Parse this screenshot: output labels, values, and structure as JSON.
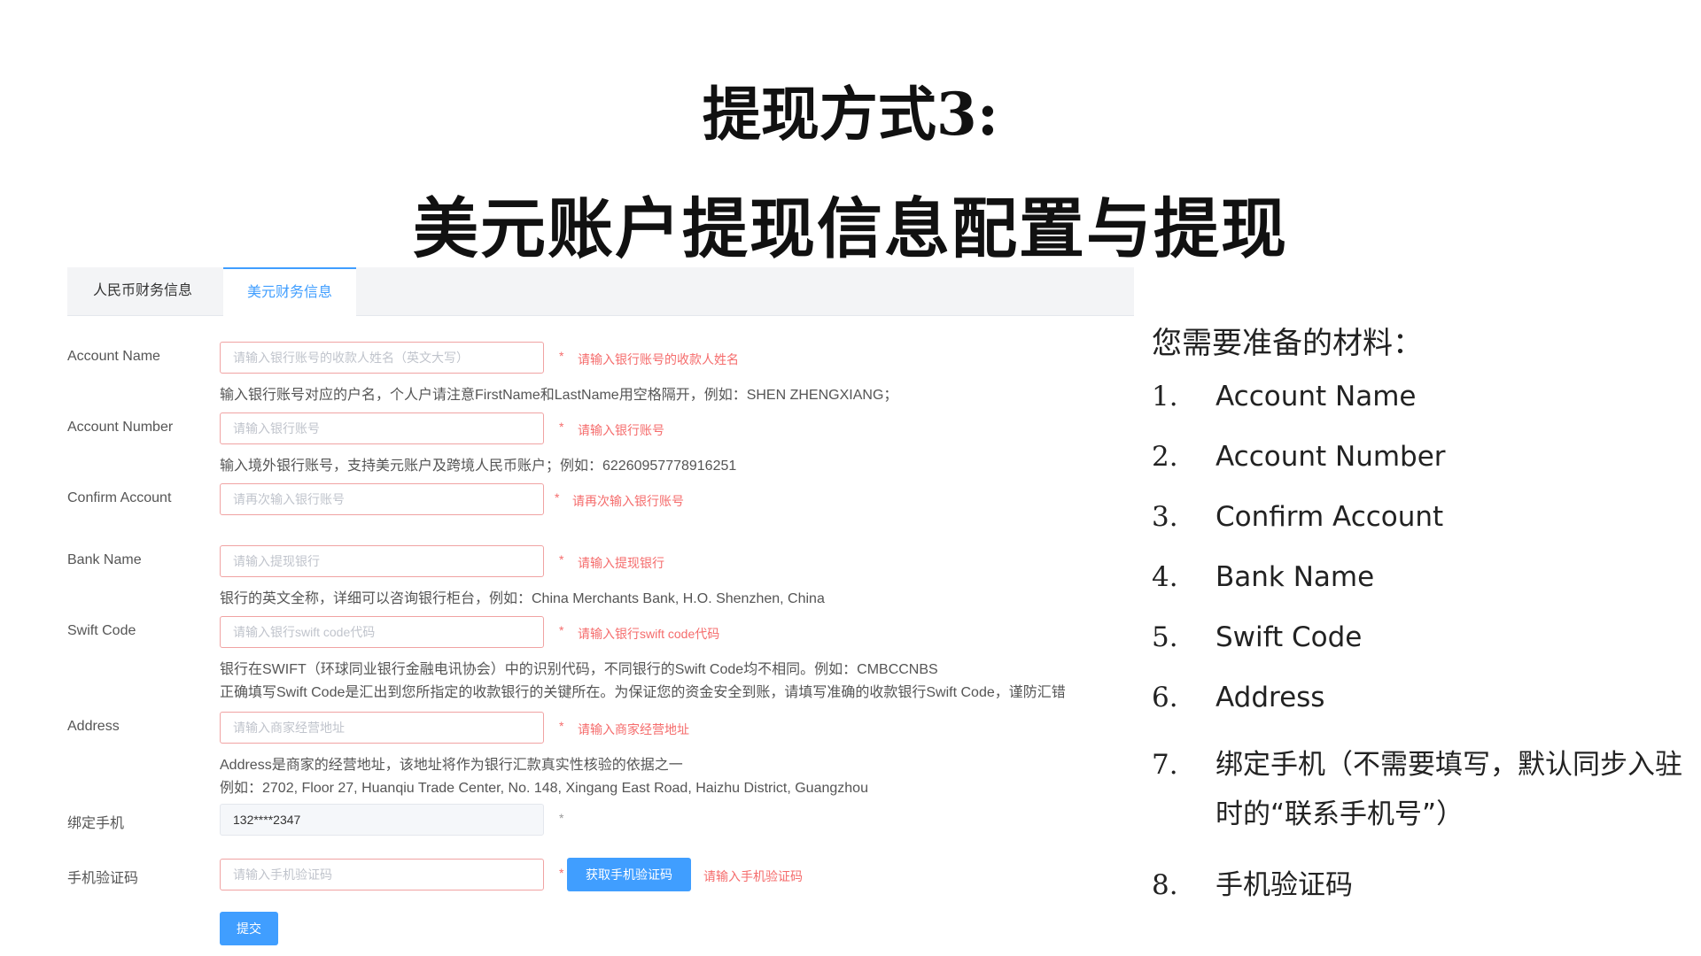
{
  "slide": {
    "title_line1": "提现方式3:",
    "title_line2": "美元账户提现信息配置与提现"
  },
  "tabs": [
    {
      "label": "人民币财务信息",
      "active": false
    },
    {
      "label": "美元财务信息",
      "active": true
    }
  ],
  "form": {
    "account_name": {
      "label": "Account Name",
      "placeholder": "请输入银行账号的收款人姓名（英文大写）",
      "required": "*",
      "error": "请输入银行账号的收款人姓名",
      "hint": "输入银行账号对应的户名，个人户请注意FirstName和LastName用空格隔开，例如：SHEN ZHENGXIANG；"
    },
    "account_number": {
      "label": "Account Number",
      "placeholder": "请输入银行账号",
      "required": "*",
      "error": "请输入银行账号",
      "hint": "输入境外银行账号，支持美元账户及跨境人民币账户；例如：62260957778916251"
    },
    "confirm_account": {
      "label": "Confirm Account",
      "placeholder": "请再次输入银行账号",
      "required": "*",
      "error": "请再次输入银行账号"
    },
    "bank_name": {
      "label": "Bank Name",
      "placeholder": "请输入提现银行",
      "required": "*",
      "error": "请输入提现银行",
      "hint": "银行的英文全称，详细可以咨询银行柜台，例如：China Merchants Bank, H.O. Shenzhen, China"
    },
    "swift_code": {
      "label": "Swift Code",
      "placeholder": "请输入银行swift code代码",
      "required": "*",
      "error": "请输入银行swift code代码",
      "hint1": "银行在SWIFT（环球同业银行金融电讯协会）中的识别代码，不同银行的Swift Code均不相同。例如：CMBCCNBS",
      "hint2": "正确填写Swift Code是汇出到您所指定的收款银行的关键所在。为保证您的资金安全到账，请填写准确的收款银行Swift Code，谨防汇错"
    },
    "address": {
      "label": "Address",
      "placeholder": "请输入商家经营地址",
      "required": "*",
      "error": "请输入商家经营地址",
      "hint1": "Address是商家的经营地址，该地址将作为银行汇款真实性核验的依据之一",
      "hint2": "例如：2702, Floor 27, Huanqiu Trade Center, No. 148, Xingang East Road, Haizhu District, Guangzhou"
    },
    "bound_phone": {
      "label": "绑定手机",
      "value": "132****2347",
      "required": "*"
    },
    "sms_code": {
      "label": "手机验证码",
      "placeholder": "请输入手机验证码",
      "required": "*",
      "button": "获取手机验证码",
      "error": "请输入手机验证码"
    },
    "submit_label": "提交"
  },
  "materials": {
    "heading": "您需要准备的材料：",
    "items": [
      {
        "num": "1.",
        "text": "Account Name"
      },
      {
        "num": "2.",
        "text": "Account Number"
      },
      {
        "num": "3.",
        "text": "Confirm Account"
      },
      {
        "num": "4.",
        "text": "Bank Name"
      },
      {
        "num": "5.",
        "text": "Swift Code"
      },
      {
        "num": "6.",
        "text": "Address"
      },
      {
        "num": "7.",
        "text": "绑定手机（不需要填写，默认同步入驻时的“联系手机号”）"
      },
      {
        "num": "8.",
        "text": "手机验证码"
      }
    ]
  }
}
